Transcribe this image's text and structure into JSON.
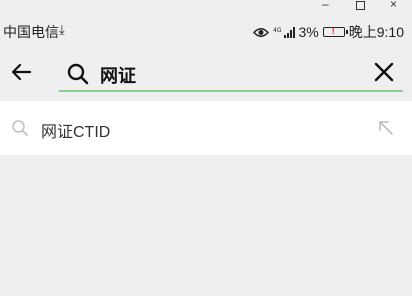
{
  "status": {
    "carrier": "中国电信",
    "battery_percent": "3%",
    "time": "晚上9:10",
    "network_label": "4G"
  },
  "search": {
    "query": "网证"
  },
  "suggestions": [
    {
      "label": "网证CTID"
    }
  ],
  "colors": {
    "background": "#efeef0",
    "search_underline": "#89cf8c",
    "battery_low": "#e0281e"
  }
}
